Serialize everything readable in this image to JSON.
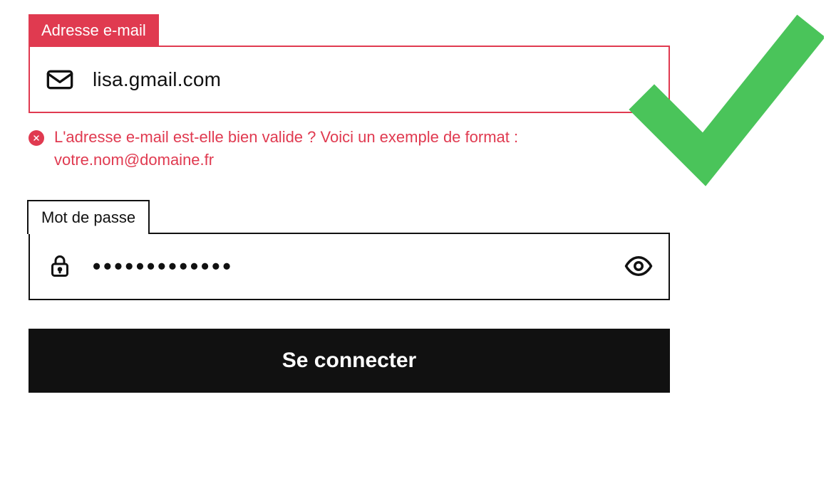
{
  "email": {
    "label": "Adresse e-mail",
    "value": "lisa.gmail.com",
    "error": "L'adresse e-mail est-elle bien valide ? Voici un exemple de format : votre.nom@domaine.fr"
  },
  "password": {
    "label": "Mot de passe",
    "masked": "•••••••••••••"
  },
  "submit": {
    "label": "Se connecter"
  }
}
